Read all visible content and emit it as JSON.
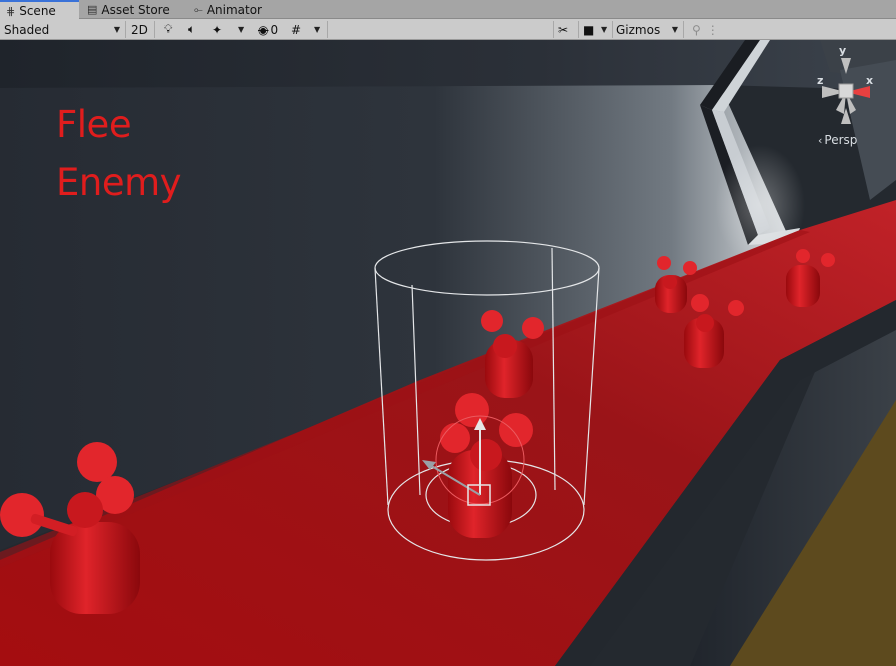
{
  "tabs": [
    {
      "label": "Scene",
      "icon": "grid-icon",
      "active": true
    },
    {
      "label": "Asset Store",
      "icon": "store-icon",
      "active": false
    },
    {
      "label": "Animator",
      "icon": "animator-icon",
      "active": false
    }
  ],
  "toolbar": {
    "draw_mode": "Shaded",
    "mode_2d": "2D",
    "hidden_count": "0",
    "gizmos_label": "Gizmos"
  },
  "scene": {
    "overlay_line1": "Flee",
    "overlay_line2": "Enemy",
    "projection": "Persp",
    "axis_x": "x",
    "axis_y": "y",
    "axis_z": "z"
  },
  "colors": {
    "label_red": "#e01d1d",
    "floor_red": "#a0121a",
    "wall": "#262b33"
  }
}
